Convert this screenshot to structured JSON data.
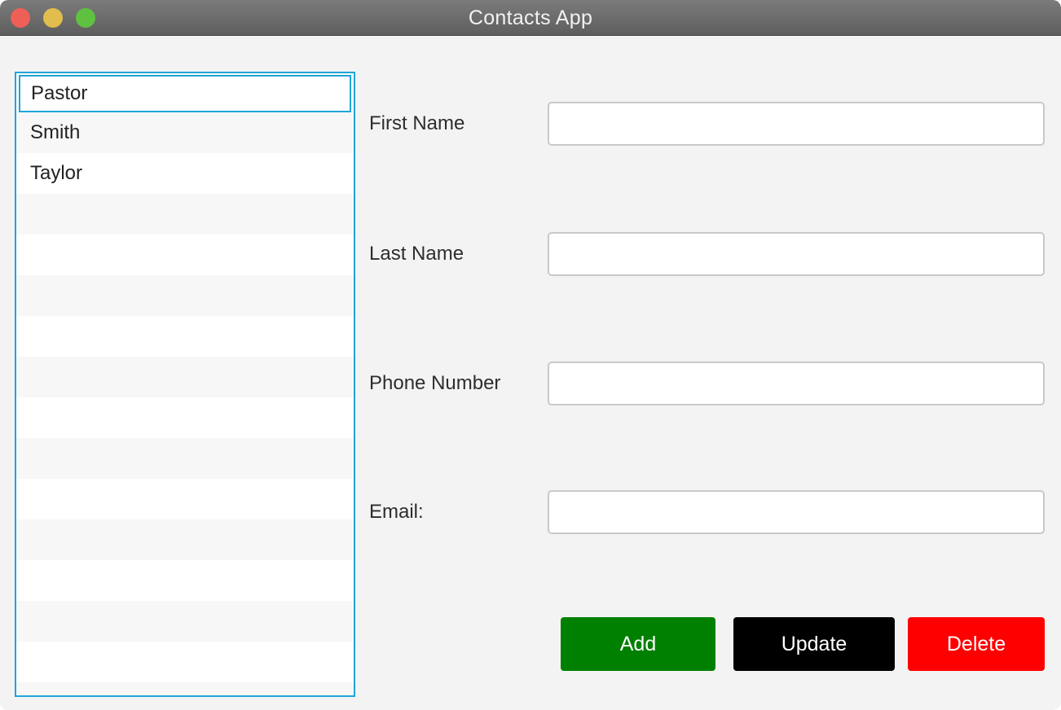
{
  "window": {
    "title": "Contacts App"
  },
  "contacts": {
    "items": [
      "Pastor",
      "Smith",
      "Taylor"
    ],
    "selected_index": 0
  },
  "form": {
    "first_name": {
      "label": "First Name",
      "value": ""
    },
    "last_name": {
      "label": "Last Name",
      "value": ""
    },
    "phone_number": {
      "label": "Phone Number",
      "value": ""
    },
    "email": {
      "label": "Email:",
      "value": ""
    }
  },
  "buttons": {
    "add": {
      "label": "Add",
      "color": "#008000"
    },
    "update": {
      "label": "Update",
      "color": "#000000"
    },
    "delete": {
      "label": "Delete",
      "color": "#ff0000"
    }
  },
  "colors": {
    "list_focus_border": "#1fa5d8",
    "window_background": "#f3f3f3"
  }
}
